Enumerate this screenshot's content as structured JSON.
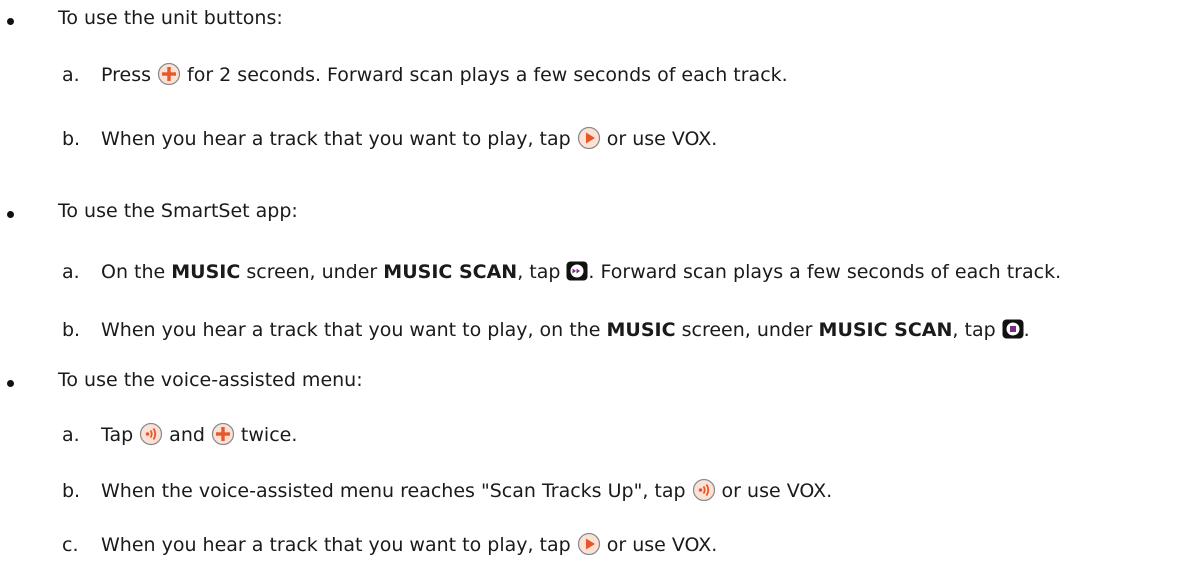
{
  "section_1": {
    "bullet": "To use the unit buttons:",
    "a": {
      "letter": "a.",
      "t1": "Press",
      "t2": "for 2 seconds. Forward scan plays a few seconds of each track."
    },
    "b": {
      "letter": "b.",
      "t1": "When you hear a track that you want to play, tap",
      "t2": "or use VOX."
    }
  },
  "section_2": {
    "bullet": "To use the SmartSet app:",
    "a": {
      "letter": "a.",
      "t1": "On the",
      "b1": "MUSIC",
      "t2": "screen, under",
      "b2": "MUSIC SCAN",
      "t3": ", tap",
      "t4": ". Forward scan plays a few seconds of each track."
    },
    "b": {
      "letter": "b.",
      "t1": "When you hear a track that you want to play, on the",
      "b1": "MUSIC",
      "t2": "screen, under",
      "b2": "MUSIC SCAN",
      "t3": ", tap",
      "t4": "."
    }
  },
  "section_3": {
    "bullet": "To use the voice-assisted menu:",
    "a": {
      "letter": "a.",
      "t1": "Tap",
      "t2": "and",
      "t3": "twice."
    },
    "b": {
      "letter": "b.",
      "t1": "When the voice-assisted menu reaches \"Scan Tracks Up\", tap",
      "t2": "or use VOX."
    },
    "c": {
      "letter": "c.",
      "t1": "When you hear a track that you want to play, tap",
      "t2": "or use VOX."
    }
  },
  "icons": {
    "plus": "plus-button-icon",
    "play": "play-button-icon",
    "forward_scan": "forward-scan-icon",
    "stop": "stop-icon",
    "voice": "voice-button-icon"
  },
  "colors": {
    "accent": "#e8572a",
    "icon_ring": "#999999",
    "stop_fill": "#7a2a8a"
  }
}
